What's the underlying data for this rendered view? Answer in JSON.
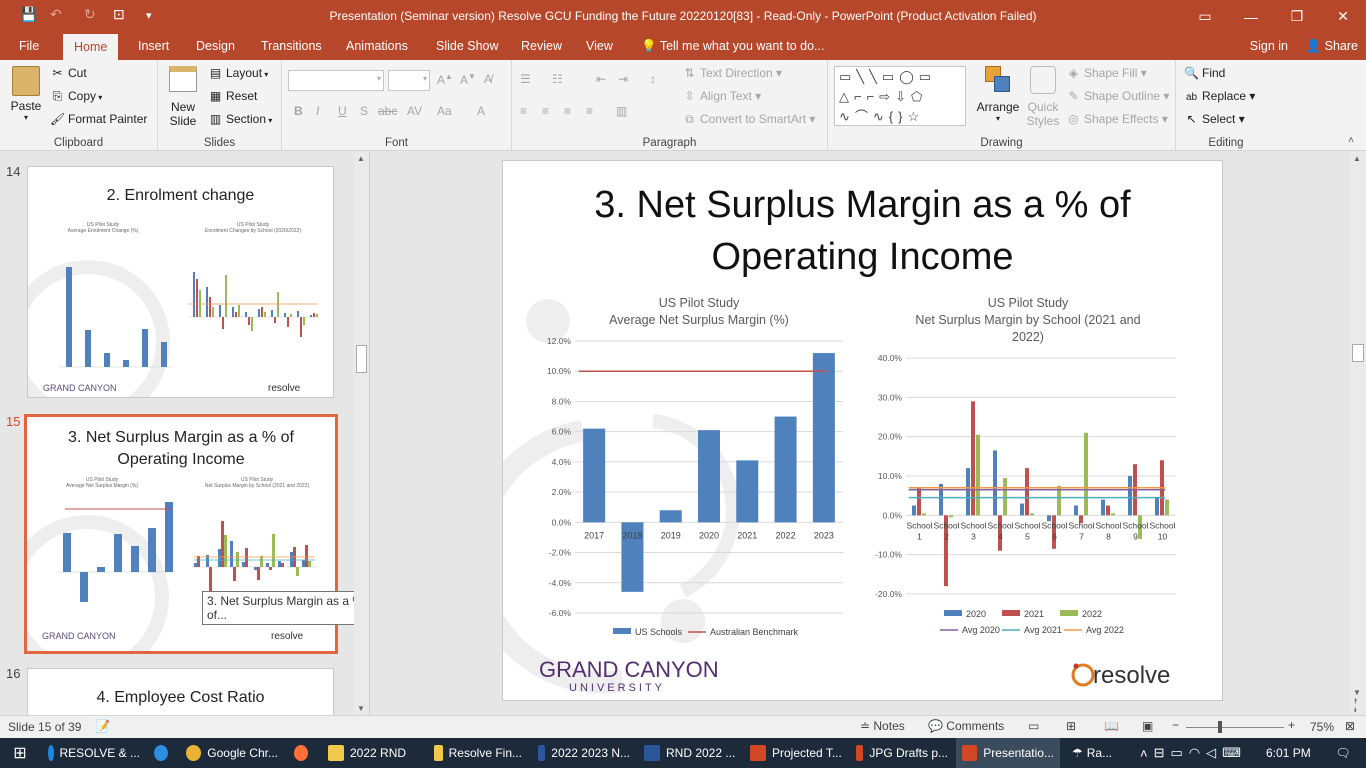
{
  "window": {
    "title": "Presentation (Seminar version) Resolve GCU Funding the Future 20220120[83]  -  Read-Only - PowerPoint (Product Activation Failed)"
  },
  "tabs": [
    "File",
    "Home",
    "Insert",
    "Design",
    "Transitions",
    "Animations",
    "Slide Show",
    "Review",
    "View"
  ],
  "active_tab": "Home",
  "tell_me": "Tell me what you want to do...",
  "sign_in": "Sign in",
  "share": "Share",
  "ribbon": {
    "clipboard": {
      "paste": "Paste",
      "cut": "Cut",
      "copy": "Copy",
      "format_painter": "Format Painter",
      "label": "Clipboard"
    },
    "slides": {
      "new_slide_1": "New",
      "new_slide_2": "Slide",
      "layout": "Layout",
      "reset": "Reset",
      "section": "Section",
      "label": "Slides"
    },
    "font": {
      "label": "Font"
    },
    "paragraph": {
      "text_direction": "Text Direction",
      "align_text": "Align Text",
      "convert_smartart": "Convert to SmartArt",
      "label": "Paragraph"
    },
    "drawing": {
      "arrange": "Arrange",
      "quick_styles_1": "Quick",
      "quick_styles_2": "Styles",
      "shape_fill": "Shape Fill",
      "shape_outline": "Shape Outline",
      "shape_effects": "Shape Effects",
      "label": "Drawing"
    },
    "editing": {
      "find": "Find",
      "replace": "Replace",
      "select": "Select",
      "label": "Editing"
    }
  },
  "thumbnails": [
    {
      "num": "14",
      "title": "2. Enrolment change",
      "chart1_t1": "US Pilot Study",
      "chart1_t2": "Average Enrolment Change (%)",
      "chart2_t1": "US Pilot Study",
      "chart2_t2": "Enrolment Changes by School (2020/2022)"
    },
    {
      "num": "15",
      "title_l1": "3. Net Surplus Margin as a % of",
      "title_l2": "Operating Income",
      "chart1_t1": "US Pilot Study",
      "chart1_t2": "Average Net Surplus Margin (%)",
      "chart2_t1": "US Pilot Study",
      "chart2_t2": "Net Surplus Margin by School (2021 and 2022)"
    },
    {
      "num": "16",
      "title": "4. Employee Cost Ratio"
    }
  ],
  "tooltip": "3. Net Surplus Margin as a % of...",
  "slide": {
    "title_l1": "3. Net Surplus Margin as a % of",
    "title_l2": "Operating Income",
    "logo_gcu_1": "GRAND CANYON",
    "logo_gcu_2": "UNIVERSITY",
    "logo_resolve": "resolve"
  },
  "chart_data": [
    {
      "type": "bar",
      "title": "US Pilot Study",
      "subtitle": "Average Net Surplus Margin (%)",
      "categories": [
        "2017",
        "2018",
        "2019",
        "2020",
        "2021",
        "2022",
        "2023"
      ],
      "series": [
        {
          "name": "US Schools",
          "values": [
            6.2,
            -4.6,
            0.8,
            6.1,
            4.1,
            7.0,
            11.2
          ],
          "color": "#4f81bd"
        },
        {
          "name": "Australian Benchmark",
          "values": [
            10.0,
            10.0,
            10.0,
            10.0,
            10.0,
            10.0,
            10.0
          ],
          "color": "#c0504d",
          "kind": "line"
        }
      ],
      "ylim": [
        -6,
        12
      ],
      "yticks": [
        "-6.0%",
        "-4.0%",
        "-2.0%",
        "0.0%",
        "2.0%",
        "4.0%",
        "6.0%",
        "8.0%",
        "10.0%",
        "12.0%"
      ],
      "legend": "bottom"
    },
    {
      "type": "bar",
      "title": "US Pilot Study",
      "subtitle_l1": "Net Surplus Margin by School (2021 and",
      "subtitle_l2": "2022)",
      "categories": [
        "School 1",
        "School 2",
        "School 3",
        "School 4",
        "School 5",
        "School 6",
        "School 7",
        "School 8",
        "School 9",
        "School 10"
      ],
      "series": [
        {
          "name": "2020",
          "values": [
            2.5,
            8.0,
            12.0,
            16.5,
            3.0,
            -1.5,
            2.5,
            4.0,
            10.0,
            4.5
          ],
          "color": "#4f81bd"
        },
        {
          "name": "2021",
          "values": [
            7.0,
            -18.0,
            29.0,
            -9.0,
            12.0,
            -8.5,
            -2.0,
            2.5,
            13.0,
            14.0
          ],
          "color": "#c0504d"
        },
        {
          "name": "2022",
          "values": [
            0.5,
            -0.5,
            20.5,
            9.5,
            0.5,
            7.5,
            21.0,
            0.5,
            -6.0,
            4.0
          ],
          "color": "#9bbb59"
        },
        {
          "name": "Avg 2020",
          "values": [
            6.5,
            6.5,
            6.5,
            6.5,
            6.5,
            6.5,
            6.5,
            6.5,
            6.5,
            6.5
          ],
          "color": "#8064a2",
          "kind": "line"
        },
        {
          "name": "Avg 2021",
          "values": [
            4.5,
            4.5,
            4.5,
            4.5,
            4.5,
            4.5,
            4.5,
            4.5,
            4.5,
            4.5
          ],
          "color": "#4bacc6",
          "kind": "line"
        },
        {
          "name": "Avg 2022",
          "values": [
            7.0,
            7.0,
            7.0,
            7.0,
            7.0,
            7.0,
            7.0,
            7.0,
            7.0,
            7.0
          ],
          "color": "#f79646",
          "kind": "line"
        }
      ],
      "ylim": [
        -20,
        40
      ],
      "yticks": [
        "-20.0%",
        "-10.0%",
        "0.0%",
        "10.0%",
        "20.0%",
        "30.0%",
        "40.0%"
      ],
      "legend": "bottom"
    }
  ],
  "status": {
    "slide_info": "Slide 15 of 39",
    "notes": "Notes",
    "comments": "Comments",
    "zoom": "75%"
  },
  "taskbar": {
    "items": [
      "RESOLVE & ...",
      "",
      "Google Chr...",
      "",
      "2022 RND",
      "Resolve Fin...",
      "2022 2023 N...",
      "RND 2022 ...",
      "Projected T...",
      "JPG Drafts p...",
      "Presentatio..."
    ],
    "weather": "Ra...",
    "time": "6:01 PM"
  }
}
